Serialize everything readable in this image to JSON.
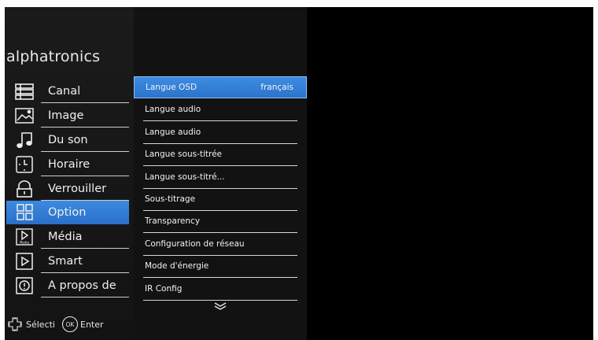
{
  "brand": "alphatronics",
  "nav": {
    "items": [
      {
        "label": "Canal",
        "icon": "list-icon"
      },
      {
        "label": "Image",
        "icon": "picture-icon"
      },
      {
        "label": "Du son",
        "icon": "music-note-icon"
      },
      {
        "label": "Horaire",
        "icon": "clock-icon"
      },
      {
        "label": "Verrouiller",
        "icon": "lock-icon"
      },
      {
        "label": "Option",
        "icon": "grid-icon",
        "active": true
      },
      {
        "label": "Média",
        "icon": "media-play-icon"
      },
      {
        "label": "Smart",
        "icon": "smart-play-icon"
      },
      {
        "label": "A propos de",
        "icon": "info-icon"
      }
    ]
  },
  "media_icon_caption": "Media",
  "submenu": {
    "items": [
      {
        "label": "Langue OSD",
        "value": "français",
        "active": true
      },
      {
        "label": "Langue audio"
      },
      {
        "label": "Langue audio"
      },
      {
        "label": "Langue sous-titrée"
      },
      {
        "label": "Langue sous-titré..."
      },
      {
        "label": "Sous-titrage"
      },
      {
        "label": "Transparency"
      },
      {
        "label": "Configuration de réseau"
      },
      {
        "label": "Mode d'énergie"
      },
      {
        "label": "IR Config"
      }
    ]
  },
  "footer": {
    "select_label": "Sélecti",
    "ok_badge": "OK",
    "enter_label": "Enter"
  },
  "colors": {
    "accent": "#2f79d2",
    "sidebar_bg": "#1b1b1b",
    "submenu_bg": "#121212"
  }
}
